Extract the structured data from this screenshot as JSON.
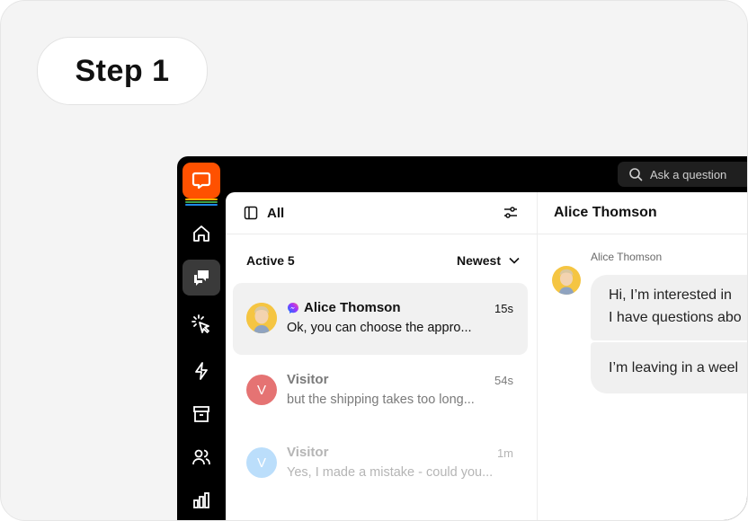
{
  "step_label": "Step 1",
  "topbar": {
    "search_placeholder": "Ask a question"
  },
  "sidebar": {
    "items": [
      {
        "icon": "home-icon"
      },
      {
        "icon": "chats-icon",
        "active": true
      },
      {
        "icon": "cursor-click-icon"
      },
      {
        "icon": "lightning-icon"
      },
      {
        "icon": "archive-icon"
      },
      {
        "icon": "users-icon"
      },
      {
        "icon": "reports-icon"
      }
    ]
  },
  "list": {
    "header_label": "All",
    "active_label": "Active 5",
    "sort_label": "Newest",
    "conversations": [
      {
        "name": "Alice Thomson",
        "time": "15s",
        "message": "Ok, you can choose the appro...",
        "selected": true,
        "channel": "messenger"
      },
      {
        "name": "Visitor",
        "initial": "V",
        "time": "54s",
        "message": "but the shipping takes too long...",
        "avatar_color": "#e57373"
      },
      {
        "name": "Visitor",
        "initial": "V",
        "time": "1m",
        "message": "Yes, I made a mistake - could you...",
        "avatar_color": "#bbdefb"
      }
    ]
  },
  "chat": {
    "title": "Alice Thomson",
    "sender": "Alice Thomson",
    "bubble1_line1": "Hi, I’m interested in",
    "bubble1_line2": "I have questions abo",
    "bubble2": "I’m leaving in a weel"
  },
  "colors": {
    "brand": "#ff5100",
    "dark": "#000000"
  }
}
